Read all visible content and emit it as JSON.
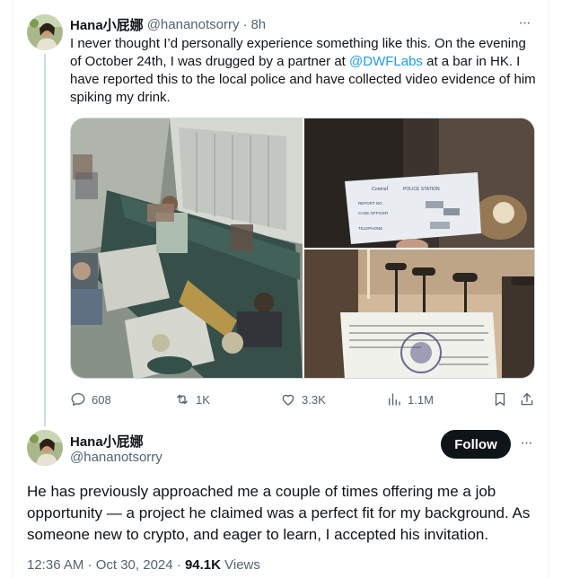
{
  "tweet1": {
    "display_name": "Hana小屁娜",
    "handle": "@hananotsorry",
    "separator": "·",
    "time_ago": "8h",
    "more_label": "···",
    "text_part1": "I never thought I’d personally experience something like this. On the evening of October 24th, I was drugged by a partner at ",
    "mention": "@DWFLabs",
    "text_part2": " at a bar in HK. I have reported this to the local police and have collected video evidence of him spiking my drink.",
    "media_card": {
      "card_header": "POLICE STATION",
      "card_text": "Central",
      "card_rows": [
        "REPORT NO.",
        "CASE OFFICER",
        "TELEPHONE"
      ]
    },
    "actions": {
      "replies": "608",
      "reposts": "1K",
      "likes": "3.3K",
      "views": "1.1M"
    }
  },
  "tweet2": {
    "display_name": "Hana小屁娜",
    "handle": "@hananotsorry",
    "follow_label": "Follow",
    "more_label": "···",
    "text": "He has previously approached me a couple of times offering me a job opportunity — a project he claimed was a perfect fit for my background. As someone new to crypto, and eager to learn, I accepted his invitation.",
    "timestamp": "12:36 AM · Oct 30, 2024",
    "separator": " · ",
    "views_count": "94.1K",
    "views_label": " Views"
  },
  "colors": {
    "text_primary": "#0f1419",
    "text_secondary": "#536471",
    "link": "#1d9bf0",
    "follow_bg": "#0f1419",
    "thread_line": "#cfd9de"
  }
}
